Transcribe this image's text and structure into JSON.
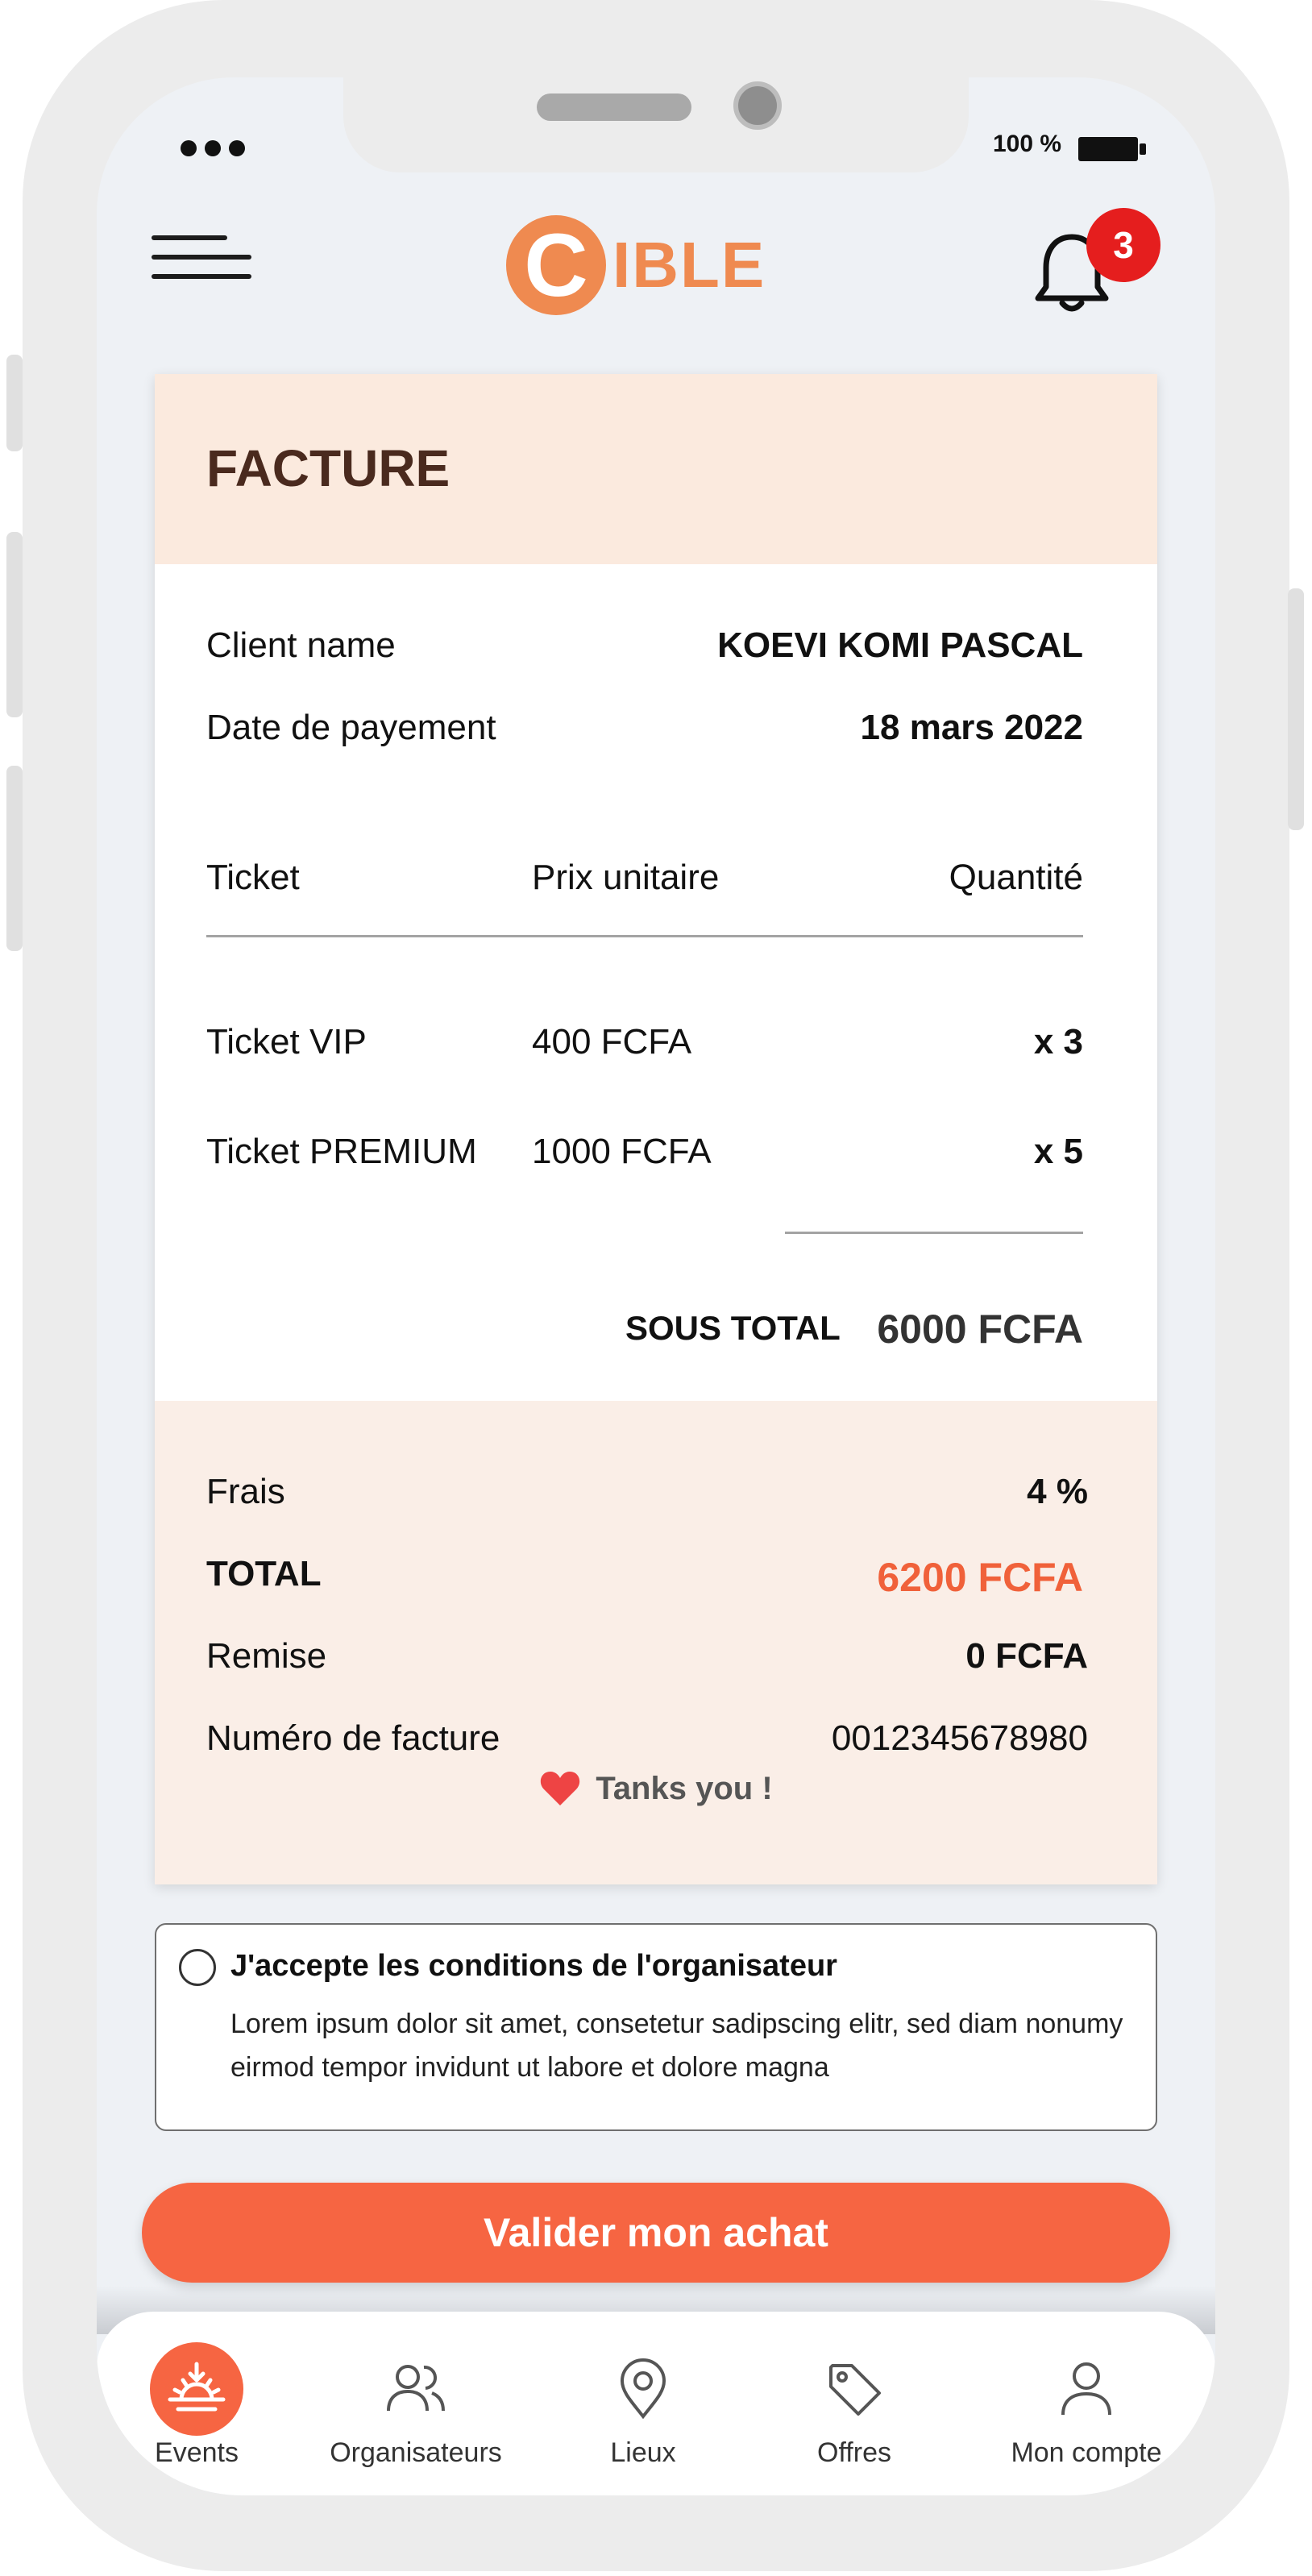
{
  "status_bar": {
    "battery": "100 %"
  },
  "header": {
    "logo_letter": "C",
    "logo_text": "IBLE",
    "notification_count": "3"
  },
  "invoice": {
    "title": "FACTURE",
    "client_label": "Client name",
    "client_value": "KOEVI KOMI PASCAL",
    "date_label": "Date de payement",
    "date_value": "18 mars 2022",
    "columns": [
      "Ticket",
      "Prix unitaire",
      "Quantité"
    ],
    "items": [
      {
        "ticket": "Ticket VIP",
        "price": "400 FCFA",
        "qty": "x 3"
      },
      {
        "ticket": "Ticket PREMIUM",
        "price": "1000 FCFA",
        "qty": "x 5"
      }
    ],
    "subtotal_label": "SOUS TOTAL",
    "subtotal_value": "6000 FCFA",
    "fees_label": "Frais",
    "fees_value": "4 %",
    "total_label": "TOTAL",
    "total_value": "6200 FCFA",
    "discount_label": "Remise",
    "discount_value": "0 FCFA",
    "invoice_number_label": "Numéro de facture",
    "invoice_number_value": "0012345678980",
    "thanks": "Tanks you !"
  },
  "terms": {
    "title": "J'accepte les conditions de l'organisateur",
    "body": "Lorem ipsum dolor sit amet, consetetur sadipscing elitr, sed diam nonumy eirmod tempor invidunt ut labore et dolore magna"
  },
  "cta_label": "Valider mon achat",
  "tabs": [
    {
      "label": "Events",
      "icon": "sunrise-icon",
      "active": true
    },
    {
      "label": "Organisateurs",
      "icon": "users-icon",
      "active": false
    },
    {
      "label": "Lieux",
      "icon": "map-pin-icon",
      "active": false
    },
    {
      "label": "Offres",
      "icon": "tag-icon",
      "active": false
    },
    {
      "label": "Mon compte",
      "icon": "user-icon",
      "active": false
    }
  ],
  "colors": {
    "accent": "#f66542",
    "brand": "#ef8a50",
    "badge": "#e51e1e",
    "header_bg": "#fbeade",
    "summary_bg": "#faeee7"
  }
}
